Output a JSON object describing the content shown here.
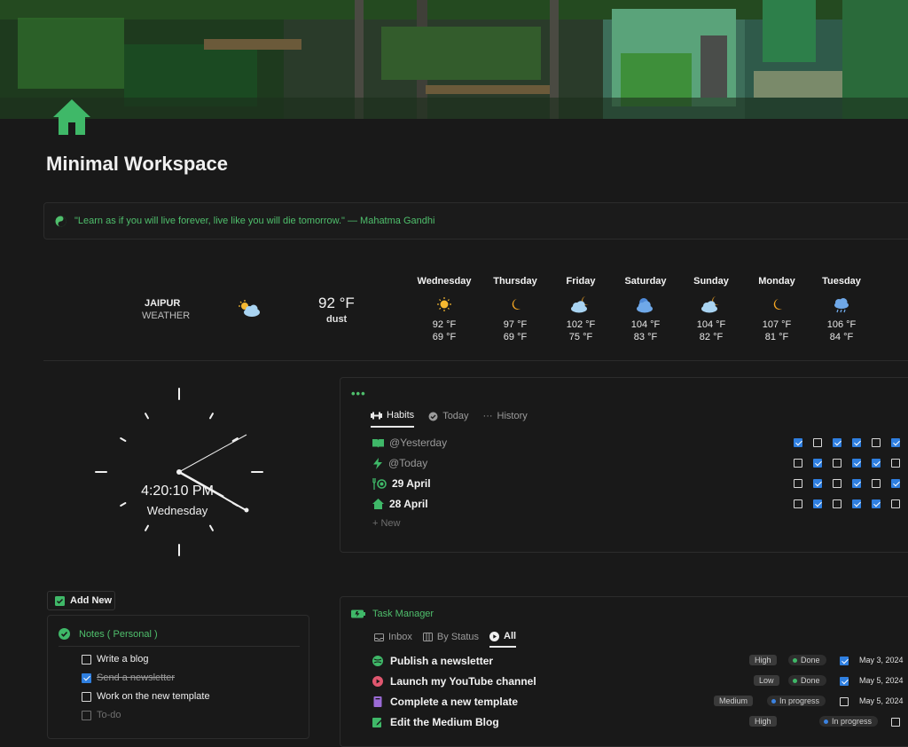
{
  "page": {
    "title": "Minimal Workspace"
  },
  "quote": {
    "text": "\"Learn as if you will live forever, live like you will die tomorrow.\" — Mahatma Gandhi"
  },
  "weather": {
    "city": "JAIPUR",
    "label": "WEATHER",
    "current": {
      "temp": "92 °F",
      "condition": "dust",
      "icon": "partly-cloudy-day-icon"
    },
    "forecast": [
      {
        "day": "Wednesday",
        "hi": "92 °F",
        "lo": "69 °F",
        "icon": "sun-icon"
      },
      {
        "day": "Thursday",
        "hi": "97 °F",
        "lo": "69 °F",
        "icon": "moon-icon"
      },
      {
        "day": "Friday",
        "hi": "102 °F",
        "lo": "75 °F",
        "icon": "cloud-moon-icon"
      },
      {
        "day": "Saturday",
        "hi": "104 °F",
        "lo": "83 °F",
        "icon": "cloud-sun-icon"
      },
      {
        "day": "Sunday",
        "hi": "104 °F",
        "lo": "82 °F",
        "icon": "cloud-moon-icon"
      },
      {
        "day": "Monday",
        "hi": "107 °F",
        "lo": "81 °F",
        "icon": "moon-icon"
      },
      {
        "day": "Tuesday",
        "hi": "106 °F",
        "lo": "84 °F",
        "icon": "rain-cloud-icon"
      }
    ]
  },
  "clock": {
    "time": "4:20:10 PM",
    "day": "Wednesday"
  },
  "habits": {
    "tabs": [
      "Habits",
      "Today",
      "History"
    ],
    "rows": [
      {
        "label": "@Yesterday",
        "icon": "book-icon",
        "dim": true,
        "checks": [
          true,
          false,
          true,
          true,
          false,
          true
        ]
      },
      {
        "label": "@Today",
        "icon": "bolt-icon",
        "dim": true,
        "checks": [
          false,
          true,
          false,
          true,
          true,
          false
        ]
      },
      {
        "label": "29 April",
        "icon": "dumbbell-icon",
        "dim": false,
        "checks": [
          false,
          true,
          false,
          true,
          false,
          true
        ]
      },
      {
        "label": "28 April",
        "icon": "home-icon",
        "dim": false,
        "checks": [
          false,
          true,
          false,
          true,
          true,
          false
        ]
      }
    ],
    "new_label": "New"
  },
  "notes": {
    "add_new": "Add New",
    "header": "Notes ( Personal )",
    "items": [
      {
        "text": "Write a blog",
        "checked": false,
        "strike": false,
        "dim": false
      },
      {
        "text": "Send a newsletter",
        "checked": true,
        "strike": true,
        "dim": false
      },
      {
        "text": "Work on the new template",
        "checked": false,
        "strike": false,
        "dim": false
      },
      {
        "text": "To-do",
        "checked": false,
        "strike": false,
        "dim": true
      }
    ]
  },
  "tasks": {
    "header": "Task Manager",
    "tabs": [
      "Inbox",
      "By Status",
      "All"
    ],
    "rows": [
      {
        "name": "Publish a newsletter",
        "icon": "globe-icon",
        "iconColor": "#3fb868",
        "priority": "High",
        "status": "Done",
        "statusColor": "#3fb868",
        "checked": true,
        "date": "May 3, 2024"
      },
      {
        "name": "Launch my YouTube channel",
        "icon": "play-icon",
        "iconColor": "#e0576f",
        "priority": "Low",
        "status": "Done",
        "statusColor": "#3fb868",
        "checked": true,
        "date": "May 5, 2024"
      },
      {
        "name": "Complete a new template",
        "icon": "book-icon",
        "iconColor": "#9b6bd6",
        "priority": "Medium",
        "status": "In progress",
        "statusColor": "#3b82e0",
        "checked": false,
        "date": "May 5, 2024"
      },
      {
        "name": "Edit the Medium Blog",
        "icon": "edit-icon",
        "iconColor": "#3fb868",
        "priority": "High",
        "status": "In progress",
        "statusColor": "#3b82e0",
        "checked": false,
        "date": ""
      }
    ]
  },
  "colors": {
    "accent": "#4fbf6c",
    "checkbox": "#2f7fe0",
    "background": "#191919"
  }
}
